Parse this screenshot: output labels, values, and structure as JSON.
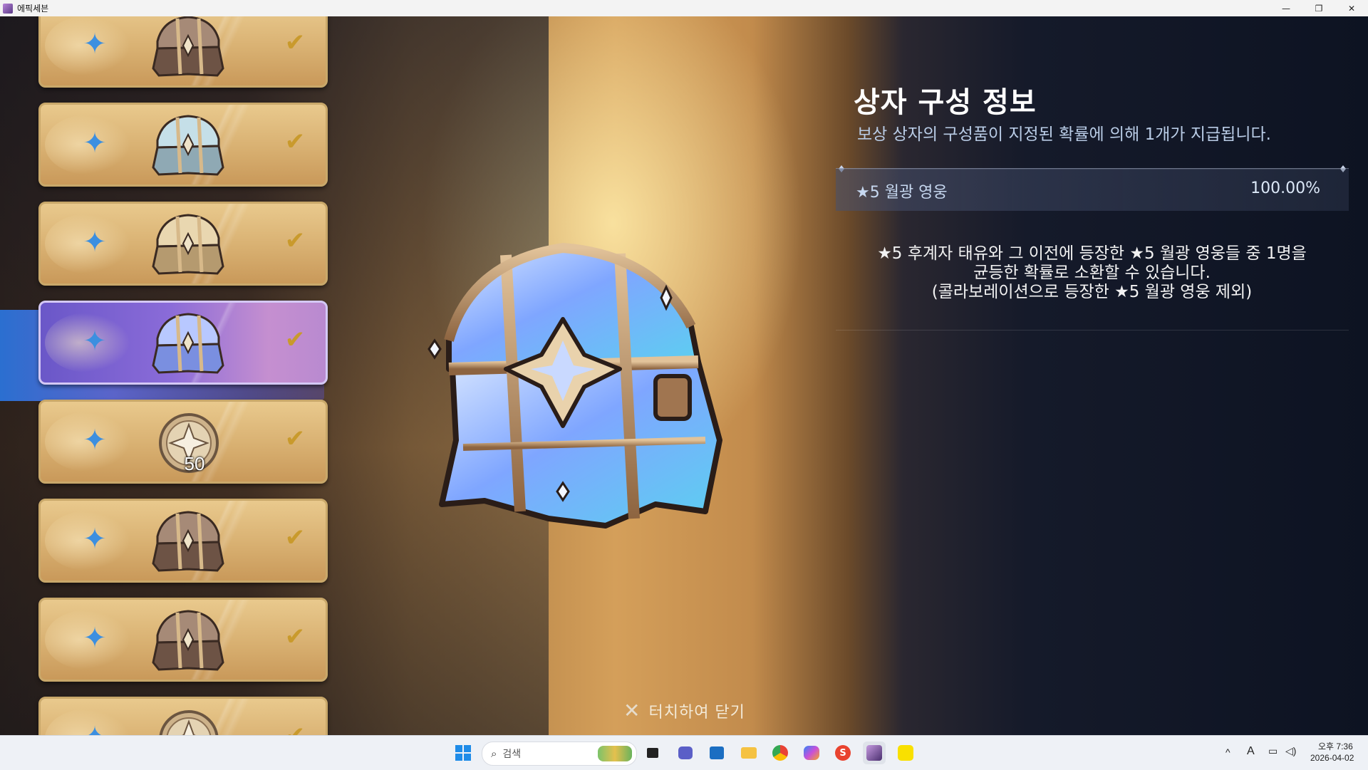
{
  "window": {
    "title": "에픽세븐",
    "controls": [
      "—",
      "❐",
      "✕"
    ]
  },
  "reward_list": {
    "items": [
      {
        "kind": "chest",
        "variant": "bronze",
        "checked": true
      },
      {
        "kind": "chest",
        "variant": "silver-blue",
        "checked": true
      },
      {
        "kind": "chest",
        "variant": "gold",
        "checked": true
      },
      {
        "kind": "chest",
        "variant": "moonlight",
        "checked": true,
        "selected": true
      },
      {
        "kind": "coin",
        "count": "50",
        "checked": true
      },
      {
        "kind": "chest",
        "variant": "bronze",
        "checked": true
      },
      {
        "kind": "chest",
        "variant": "bronze",
        "checked": true
      },
      {
        "kind": "coin",
        "checked": true
      }
    ],
    "check_glyph": "✔",
    "star_glyph": "✦"
  },
  "info": {
    "title": "상자 구성 정보",
    "subtitle": "보상 상자의 구성품이 지정된 확률에 의해 1개가 지급됩니다.",
    "rates": [
      {
        "name": "★5 월광 영웅",
        "value": "100.00%"
      }
    ],
    "description_lines": [
      "★5 후계자 태유와 그 이전에 등장한 ★5 월광 영웅들 중 1명을",
      "균등한 확률로 소환할 수 있습니다.",
      "(콜라보레이션으로 등장한 ★5 월광 영웅 제외)"
    ]
  },
  "close_hint": {
    "icon": "✕",
    "label": "터치하여 닫기"
  },
  "taskbar": {
    "search_placeholder": "검색",
    "tray": {
      "expand": "^",
      "ime": "A",
      "time": "오후 7:36",
      "date": "2026-04-02"
    }
  },
  "colors": {
    "accent_blue": "#3c8fe0",
    "check_gold": "#c99a2c",
    "subtitle": "#b9cce6"
  }
}
